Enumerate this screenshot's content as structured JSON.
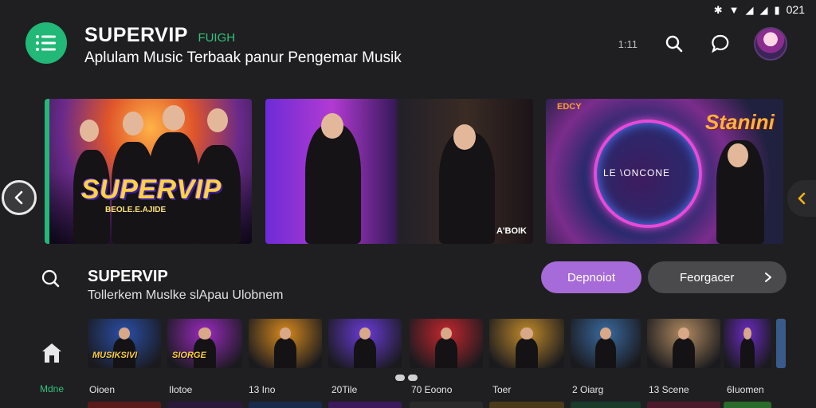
{
  "status_bar": {
    "time": "021",
    "icons": [
      "bluetooth-icon",
      "wifi-icon",
      "signal-icon",
      "signal-icon",
      "battery-icon"
    ]
  },
  "header": {
    "title": "SUPERVIP",
    "tag": "FUIGH",
    "subtitle": "Aplulam Music Terbaak panur Pengemar Musik",
    "count": "1:11"
  },
  "banners": [
    {
      "title": "SUPERVIP",
      "subtitle": "BEOLE.E.AJIDE"
    },
    {
      "tag": "A'BOIK"
    },
    {
      "logo": "Stanini",
      "corner": "EDCY",
      "ring_label": "LE \\ONCONE"
    }
  ],
  "section": {
    "title": "SUPERVIP",
    "subtitle": "Tollerkem Muslke slApau Ulobnem",
    "primary_button": "Depnoiot",
    "secondary_button": "Feorgacer"
  },
  "nav": {
    "home_label": "Mdne"
  },
  "thumbnails": [
    {
      "label": "Oioen",
      "title": "MUSIKSIVI",
      "color": "#2a4fa8"
    },
    {
      "label": "Ilotoe",
      "title": "SIORGE",
      "color": "#9b2ac0"
    },
    {
      "label": "13 Ino",
      "title": "",
      "color": "#d88a1e"
    },
    {
      "label": "20Tile",
      "title": "",
      "color": "#6a3bd8"
    },
    {
      "label": "70 Eoono",
      "title": "",
      "color": "#c4262e"
    },
    {
      "label": "Toer",
      "title": "",
      "color": "#c08a2a"
    },
    {
      "label": "2 Oiarg",
      "title": "",
      "color": "#3a6aa0"
    },
    {
      "label": "13 Scene",
      "title": "",
      "color": "#b08a60"
    },
    {
      "label": "6Iuomen",
      "title": "",
      "color": "#6a2ac0"
    }
  ]
}
